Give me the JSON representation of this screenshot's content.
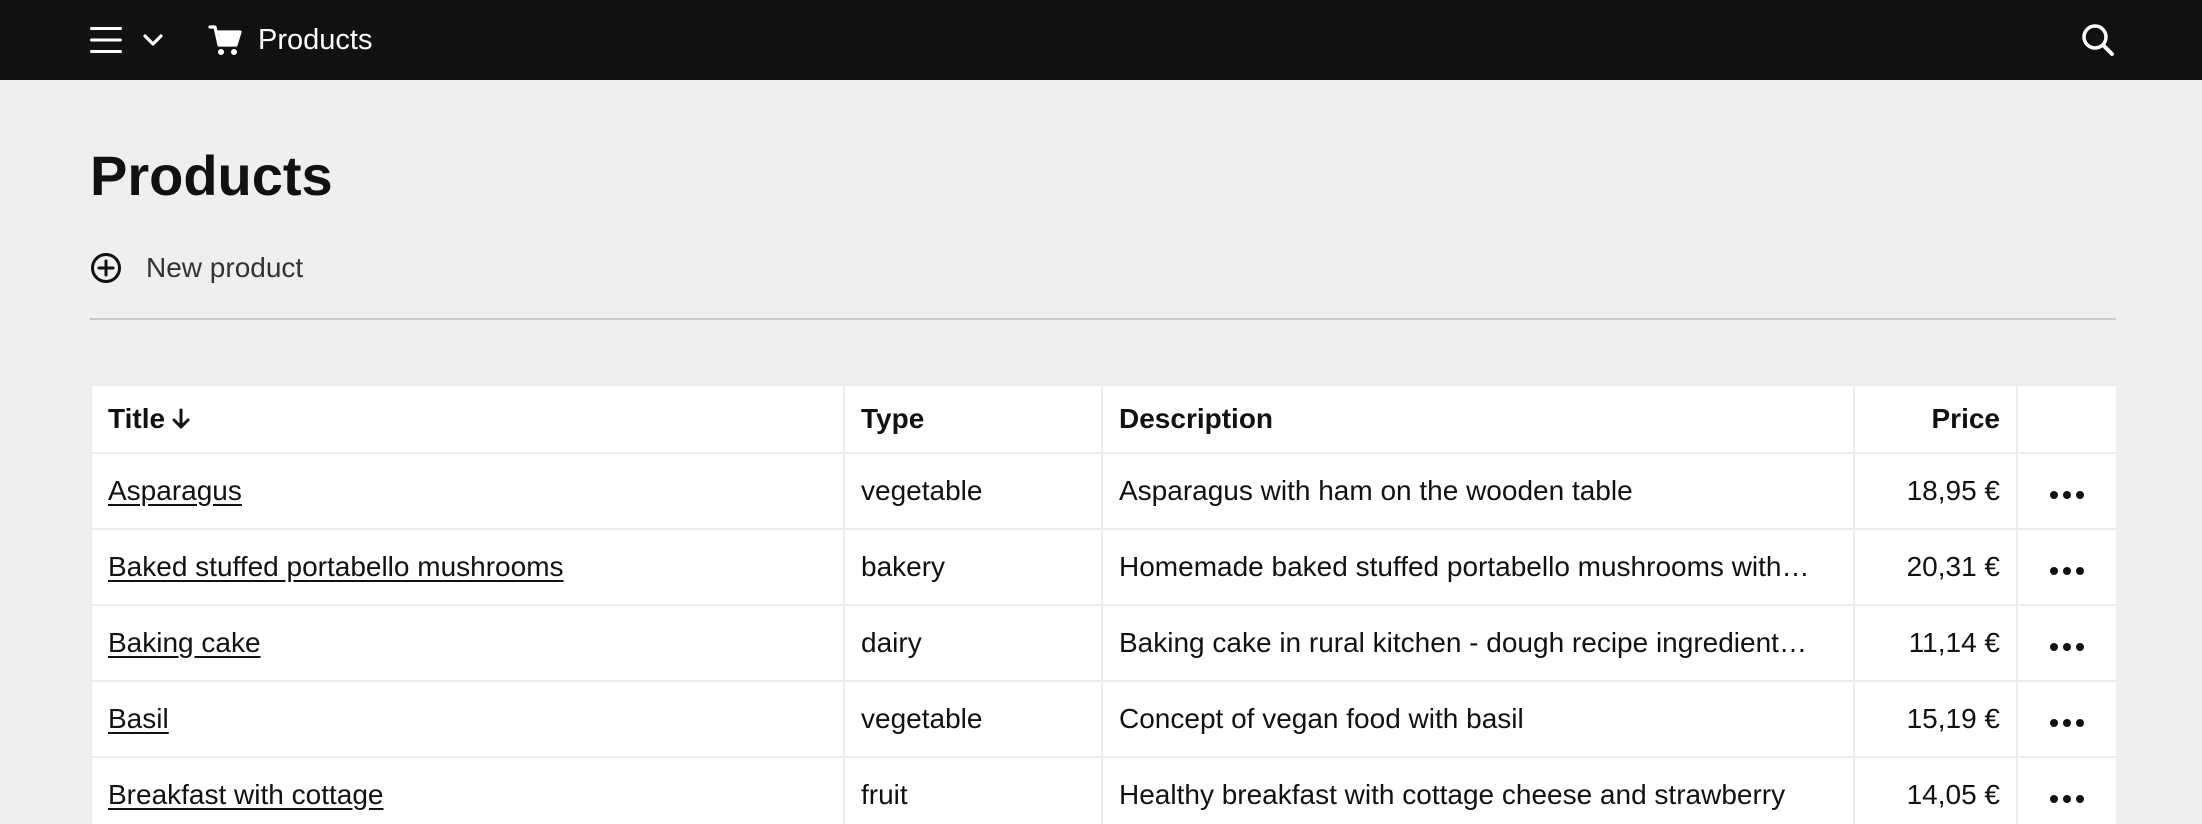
{
  "header": {
    "app_title": "Products",
    "icons": [
      "menu-icon",
      "chevron-down-icon",
      "cart-icon",
      "search-icon"
    ]
  },
  "main": {
    "page_title": "Products",
    "new_product_label": "New product"
  },
  "table": {
    "columns": {
      "title": "Title",
      "type": "Type",
      "description": "Description",
      "price": "Price"
    },
    "sort": {
      "column": "Title",
      "direction": "descending-arrow"
    },
    "rows": [
      {
        "title": "Asparagus",
        "type": "vegetable",
        "description": "Asparagus with ham on the wooden table",
        "price": "18,95 €"
      },
      {
        "title": "Baked stuffed portabello mushrooms",
        "type": "bakery",
        "description": "Homemade baked stuffed portabello mushrooms with…",
        "price": "20,31 €"
      },
      {
        "title": "Baking cake",
        "type": "dairy",
        "description": "Baking cake in rural kitchen - dough recipe ingredient…",
        "price": "11,14 €"
      },
      {
        "title": "Basil",
        "type": "vegetable",
        "description": "Concept of vegan food with basil",
        "price": "15,19 €"
      },
      {
        "title": "Breakfast with cottage",
        "type": "fruit",
        "description": "Healthy breakfast with cottage cheese and strawberry",
        "price": "14,05 €"
      }
    ]
  },
  "colors": {
    "topbar": "#111111",
    "background": "#efefef",
    "table_bg": "#ffffff",
    "border": "#ececec"
  }
}
